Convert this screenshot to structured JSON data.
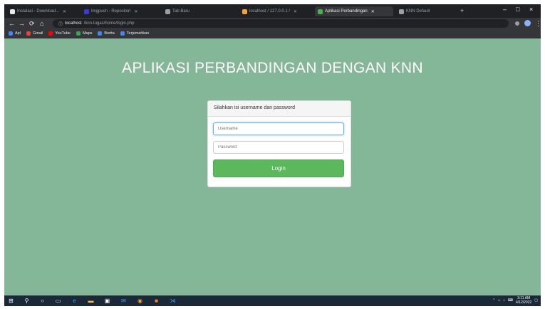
{
  "browser": {
    "tabs": [
      {
        "label": "Instalasi - Download...",
        "favicon_color": "#e8eaed"
      },
      {
        "label": "Imgpush - Repositori",
        "favicon_color": "#3b3bd9"
      },
      {
        "label": "Tab Baru",
        "favicon_color": "#9aa0a6"
      },
      {
        "label": "localhost / 127.0.0.1 /",
        "favicon_color": "#f2a33a"
      },
      {
        "label": "Aplikasi Perbandingan",
        "favicon_color": "#4caf50"
      },
      {
        "label": "KNN Default",
        "favicon_color": "#9aa0a6"
      }
    ],
    "new_tab_label": "+",
    "window_controls": [
      "–",
      "□",
      "×"
    ],
    "nav": {
      "back": "←",
      "forward": "→",
      "reload": "⟳",
      "home": "⌂"
    },
    "address": {
      "host": "localhost",
      "path": "/knn-tugas/home/login.php"
    },
    "bookmarks": [
      {
        "label": "Apl",
        "color": "#4285f4"
      },
      {
        "label": "Gmail",
        "color": "#ea4335"
      },
      {
        "label": "YouTube",
        "color": "#ff0000"
      },
      {
        "label": "Maps",
        "color": "#34a853"
      },
      {
        "label": "Berita",
        "color": "#4285f4"
      },
      {
        "label": "Terjemahkan",
        "color": "#4285f4"
      }
    ]
  },
  "page": {
    "title": "APLIKASI PERBANDINGAN DENGAN KNN",
    "login": {
      "heading": "Silahkan isi username dan password",
      "username_placeholder": "Username",
      "password_placeholder": "Password",
      "button_label": "Login"
    }
  },
  "colors": {
    "page_background": "#84b797",
    "login_button": "#5cb85c"
  },
  "taskbar": {
    "apps": [
      {
        "name": "windows-start",
        "glyph": "⊞",
        "color": "#ffffff"
      },
      {
        "name": "search",
        "glyph": "⚲",
        "color": "#ffffff"
      },
      {
        "name": "cortana",
        "glyph": "○",
        "color": "#ffffff"
      },
      {
        "name": "task-view",
        "glyph": "▭",
        "color": "#ffffff"
      },
      {
        "name": "edge",
        "glyph": "e",
        "color": "#3ba0ff"
      },
      {
        "name": "file-explorer",
        "glyph": "▬",
        "color": "#f3c242"
      },
      {
        "name": "store",
        "glyph": "▣",
        "color": "#ffffff"
      },
      {
        "name": "mail",
        "glyph": "✉",
        "color": "#3ba0ff"
      },
      {
        "name": "chrome",
        "glyph": "◉",
        "color": "#f2a33a"
      },
      {
        "name": "app-orange",
        "glyph": "■",
        "color": "#f08a24"
      },
      {
        "name": "vscode",
        "glyph": "⋊",
        "color": "#3ba0ff"
      }
    ],
    "time": "3:11 AM",
    "date": "4/12/2022"
  }
}
